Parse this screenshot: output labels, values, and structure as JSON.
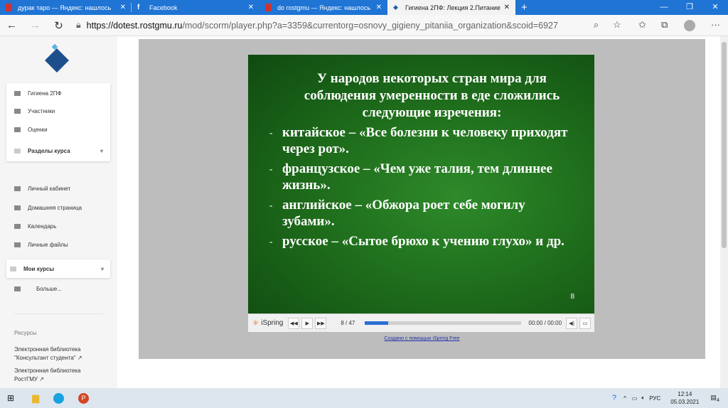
{
  "browser": {
    "tabs": [
      {
        "label": "дурак таро — Яндекс: нашлось"
      },
      {
        "label": "Facebook"
      },
      {
        "label": "do rostgmu — Яндекс: нашлось"
      },
      {
        "label": "Гигиена 2ПФ: Лекция 2.Питание"
      }
    ],
    "url_host": "https://dotest.rostgmu.ru",
    "url_path": "/mod/scorm/player.php?a=3359&currentorg=osnovy_gigieny_pitaniia_organization&scoid=6927"
  },
  "sidebar": {
    "course_items": [
      {
        "label": "Гигиена 2ПФ"
      },
      {
        "label": "Участники"
      },
      {
        "label": "Оценки"
      },
      {
        "label": "Разделы курса"
      }
    ],
    "nav_items": [
      {
        "label": "Личный кабинет"
      },
      {
        "label": "Домашняя страница"
      },
      {
        "label": "Календарь"
      },
      {
        "label": "Личные файлы"
      }
    ],
    "my_courses": "Мои курсы",
    "more": "Больше...",
    "resources_title": "Ресурсы",
    "links": [
      {
        "label": "Электронная библиотека \"Консультант студента\""
      },
      {
        "label": "Электронная библиотека РостГМУ"
      }
    ]
  },
  "slide": {
    "title": "У народов некоторых стран мира для соблюдения умеренности в еде сложились следующие изречения:",
    "items": [
      {
        "bullet": "-",
        "text": "китайское – «Все болезни к человеку приходят через рот»."
      },
      {
        "bullet": "-",
        "text": "французское – «Чем уже талия, тем длиннее жизнь»."
      },
      {
        "bullet": "-",
        "text": "английское – «Обжора роет себе могилу зубами»."
      },
      {
        "bullet": "-",
        "text": "русское – «Сытое брюхо к учению глухо» и др."
      }
    ],
    "page_number": "8"
  },
  "player": {
    "brand": "iSpring",
    "counter": "8 / 47",
    "progress": 0.15,
    "time": "00:00 / 00:00",
    "credit": "Создано с помощью iSpring Free"
  },
  "taskbar": {
    "lang": "РУС",
    "time": "12:14",
    "date": "05.03.2021",
    "notifications": "4"
  }
}
